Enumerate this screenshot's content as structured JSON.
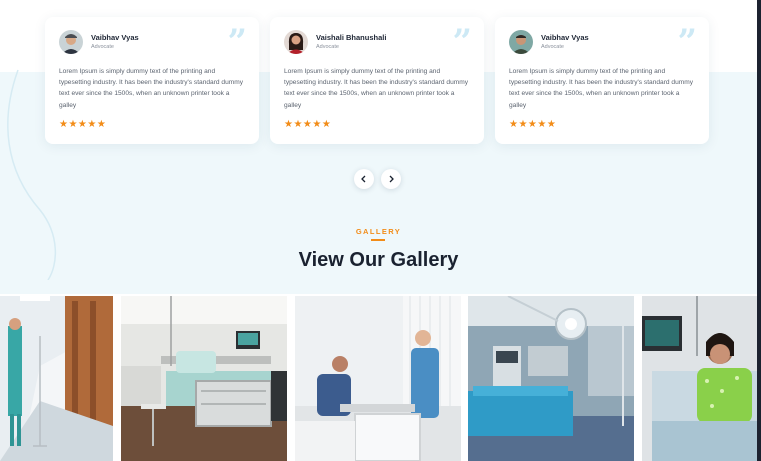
{
  "testimonials": [
    {
      "name": "Vaibhav Vyas",
      "role": "Advocate",
      "text": "Lorem Ipsum is simply dummy text of the printing and typesetting industry. It has been the industry's standard dummy text ever since the 1500s, when an unknown printer took a galley",
      "rating": 5,
      "stars": "★★★★★",
      "avatar": "man-with-cap-avatar"
    },
    {
      "name": "Vaishali Bhanushali",
      "role": "Advocate",
      "text": "Lorem Ipsum is simply dummy text of the printing and typesetting industry. It has been the industry's standard dummy text ever since the 1500s, when an unknown printer took a galley",
      "rating": 5,
      "stars": "★★★★★",
      "avatar": "woman-avatar"
    },
    {
      "name": "Vaibhav Vyas",
      "role": "Advocate",
      "text": "Lorem Ipsum is simply dummy text of the printing and typesetting industry. It has been the industry's standard dummy text ever since the 1500s, when an unknown printer took a galley",
      "rating": 5,
      "stars": "★★★★★",
      "avatar": "man-avatar"
    }
  ],
  "gallery": {
    "eyebrow": "GALLERY",
    "title": "View Our Gallery",
    "images": [
      "hospital-corridor-photo",
      "hospital-bed-room-photo",
      "nurse-with-patient-photo",
      "operating-room-photo",
      "patient-in-bed-photo"
    ]
  },
  "colors": {
    "accent": "#f28c18",
    "heading": "#1a2230",
    "band": "#eff8fb",
    "quote": "#cde9f5"
  }
}
